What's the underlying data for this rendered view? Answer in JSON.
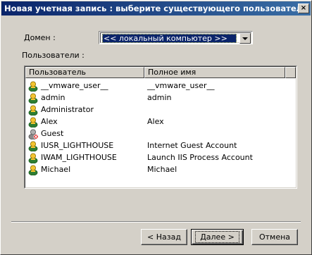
{
  "window": {
    "title": "Новая учетная запись : выберите существующего пользователя",
    "close_glyph": "×"
  },
  "domain": {
    "label": "Домен :",
    "selected": "<< локальный компьютер >>"
  },
  "users_label": "Пользователи :",
  "list": {
    "columns": [
      "Пользователь",
      "Полное имя"
    ],
    "rows": [
      {
        "user": "__vmware_user__",
        "full_name": "__vmware_user__",
        "icon": "user-icon"
      },
      {
        "user": "admin",
        "full_name": "admin",
        "icon": "user-icon"
      },
      {
        "user": "Administrator",
        "full_name": "",
        "icon": "user-icon"
      },
      {
        "user": "Alex",
        "full_name": "Alex",
        "icon": "user-icon"
      },
      {
        "user": "Guest",
        "full_name": "",
        "icon": "disabled-user-icon"
      },
      {
        "user": "IUSR_LIGHTHOUSE",
        "full_name": "Internet Guest Account",
        "icon": "user-icon"
      },
      {
        "user": "IWAM_LIGHTHOUSE",
        "full_name": "Launch IIS Process Account",
        "icon": "user-icon"
      },
      {
        "user": "Michael",
        "full_name": "Michael",
        "icon": "user-icon"
      }
    ]
  },
  "buttons": {
    "back": "< Назад",
    "next": "Далее >",
    "cancel": "Отмена"
  },
  "colors": {
    "titlebar_start": "#0a246a",
    "titlebar_end": "#3a6ea5",
    "dialog_bg": "#d4d0c8",
    "selection": "#0a246a"
  }
}
